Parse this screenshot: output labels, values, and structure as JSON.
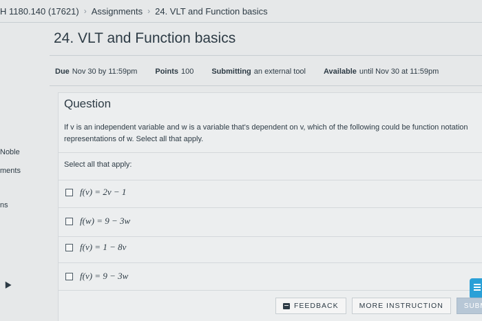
{
  "breadcrumb": {
    "course": "H 1180.140 (17621)",
    "section": "Assignments",
    "current": "24. VLT and Function basics"
  },
  "left_nav": {
    "items": [
      "Noble",
      "ments",
      "ns"
    ]
  },
  "assignment": {
    "title": "24. VLT and Function basics",
    "details": {
      "due_key": "Due",
      "due_value": "Nov 30 by 11:59pm",
      "points_key": "Points",
      "points_value": "100",
      "submitting_key": "Submitting",
      "submitting_value": "an external tool",
      "available_key": "Available",
      "available_value": "until Nov 30 at 11:59pm"
    }
  },
  "question": {
    "title": "Question",
    "text": "If v is an independent variable and w is a variable that's dependent on v, which of the following could be function notation representations of w. Select all that apply.",
    "prompt": "Select all that apply:",
    "options": [
      "f(v) = 2v − 1",
      "f(w) = 9 − 3w",
      "f(v) = 1 − 8v",
      "f(v) = 9 − 3w"
    ]
  },
  "buttons": {
    "feedback": "FEEDBACK",
    "more_instruction": "MORE INSTRUCTION",
    "submit": "SUBM"
  },
  "icons": {
    "feedback": "feedback-icon",
    "widget": "chat-widget-icon",
    "cursor": "mouse-cursor-icon"
  }
}
